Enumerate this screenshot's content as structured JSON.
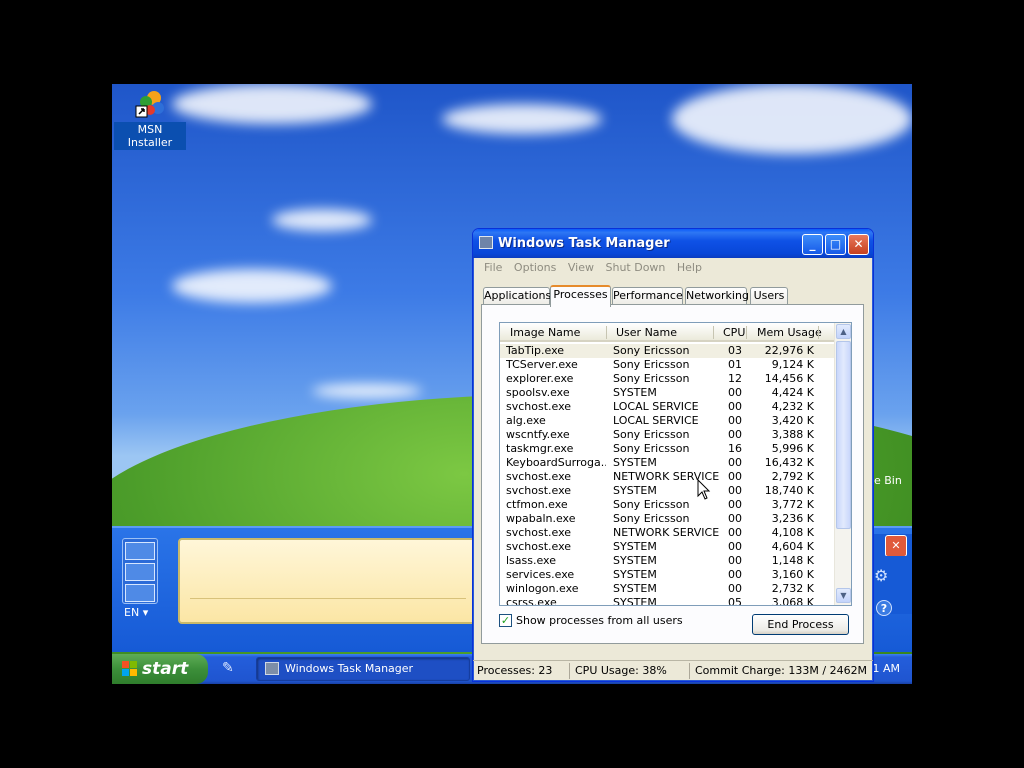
{
  "desktop": {
    "icons": [
      {
        "label": "MSN Installer"
      }
    ],
    "partial_icon_label": "e Bin"
  },
  "tip": {
    "lang": "EN"
  },
  "taskbar": {
    "start_label": "start",
    "task_label": "Windows Task Manager",
    "clock_partial": "1 AM"
  },
  "taskmgr": {
    "title": "Windows Task Manager",
    "menu": [
      "File",
      "Options",
      "View",
      "Shut Down",
      "Help"
    ],
    "tabs": [
      "Applications",
      "Processes",
      "Performance",
      "Networking",
      "Users"
    ],
    "active_tab": "Processes",
    "columns": [
      "Image Name",
      "User Name",
      "CPU",
      "Mem Usage"
    ],
    "rows": [
      {
        "name": "TabTip.exe",
        "user": "Sony Ericsson",
        "cpu": "03",
        "mem": "22,976 K"
      },
      {
        "name": "TCServer.exe",
        "user": "Sony Ericsson",
        "cpu": "01",
        "mem": "9,124 K"
      },
      {
        "name": "explorer.exe",
        "user": "Sony Ericsson",
        "cpu": "12",
        "mem": "14,456 K"
      },
      {
        "name": "spoolsv.exe",
        "user": "SYSTEM",
        "cpu": "00",
        "mem": "4,424 K"
      },
      {
        "name": "svchost.exe",
        "user": "LOCAL SERVICE",
        "cpu": "00",
        "mem": "4,232 K"
      },
      {
        "name": "alg.exe",
        "user": "LOCAL SERVICE",
        "cpu": "00",
        "mem": "3,420 K"
      },
      {
        "name": "wscntfy.exe",
        "user": "Sony Ericsson",
        "cpu": "00",
        "mem": "3,388 K"
      },
      {
        "name": "taskmgr.exe",
        "user": "Sony Ericsson",
        "cpu": "16",
        "mem": "5,996 K"
      },
      {
        "name": "KeyboardSurroga...",
        "user": "SYSTEM",
        "cpu": "00",
        "mem": "16,432 K"
      },
      {
        "name": "svchost.exe",
        "user": "NETWORK SERVICE",
        "cpu": "00",
        "mem": "2,792 K"
      },
      {
        "name": "svchost.exe",
        "user": "SYSTEM",
        "cpu": "00",
        "mem": "18,740 K"
      },
      {
        "name": "ctfmon.exe",
        "user": "Sony Ericsson",
        "cpu": "00",
        "mem": "3,772 K"
      },
      {
        "name": "wpabaln.exe",
        "user": "Sony Ericsson",
        "cpu": "00",
        "mem": "3,236 K"
      },
      {
        "name": "svchost.exe",
        "user": "NETWORK SERVICE",
        "cpu": "00",
        "mem": "4,108 K"
      },
      {
        "name": "svchost.exe",
        "user": "SYSTEM",
        "cpu": "00",
        "mem": "4,604 K"
      },
      {
        "name": "lsass.exe",
        "user": "SYSTEM",
        "cpu": "00",
        "mem": "1,148 K"
      },
      {
        "name": "services.exe",
        "user": "SYSTEM",
        "cpu": "00",
        "mem": "3,160 K"
      },
      {
        "name": "winlogon.exe",
        "user": "SYSTEM",
        "cpu": "00",
        "mem": "2,732 K"
      },
      {
        "name": "csrss.exe",
        "user": "SYSTEM",
        "cpu": "05",
        "mem": "3,068 K"
      }
    ],
    "show_all_label": "Show processes from all users",
    "show_all_checked": true,
    "end_process_label": "End Process",
    "status": {
      "processes": "Processes: 23",
      "cpu": "CPU Usage: 38%",
      "commit": "Commit Charge: 133M / 2462M"
    }
  },
  "colors": {
    "titlebar": "#0846d8",
    "active_tab_accent": "#e68b2c",
    "start_green": "#3c8f3a"
  }
}
